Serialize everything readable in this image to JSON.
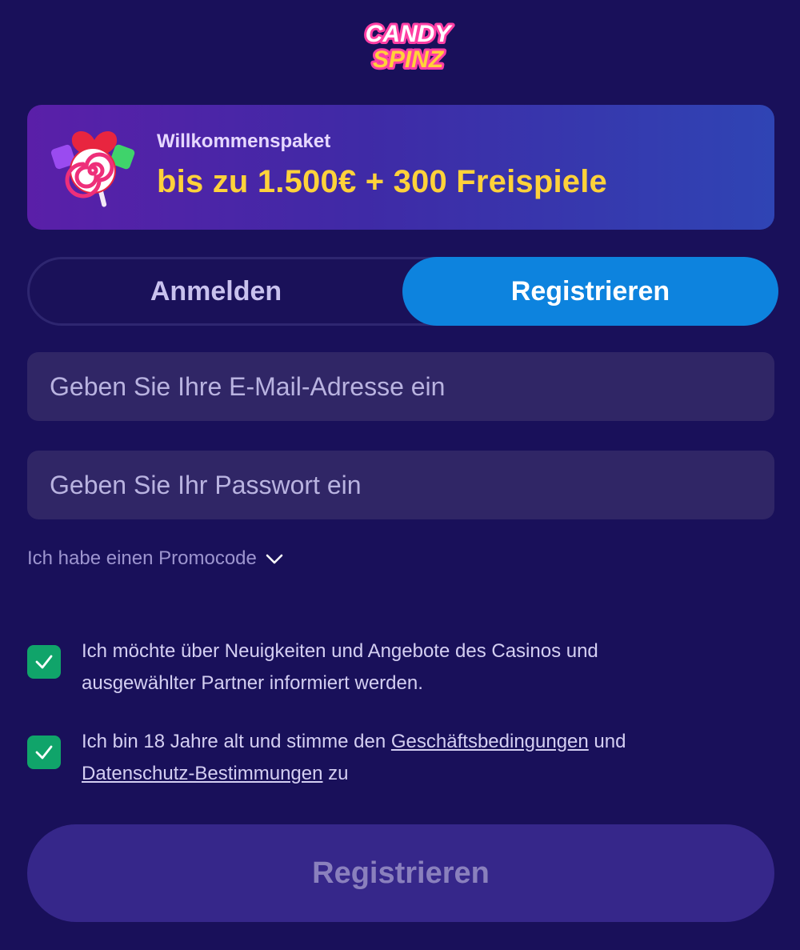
{
  "logo": {
    "line1": "CANDY",
    "line2": "SPINZ"
  },
  "banner": {
    "icon": "candy-lollipop-icon",
    "label": "Willkommenspaket",
    "offer": "bis zu 1.500€ + 300 Freispiele"
  },
  "tabs": {
    "login": "Anmelden",
    "register": "Registrieren",
    "active": "register"
  },
  "form": {
    "email_placeholder": "Geben Sie Ihre E-Mail-Adresse ein",
    "email_value": "",
    "password_placeholder": "Geben Sie Ihr Passwort ein",
    "password_value": "",
    "promo_label": "Ich habe einen Promocode",
    "promo_icon": "chevron-down-icon",
    "newsletter": {
      "checked": true,
      "text": "Ich möchte über Neuigkeiten und Angebote des Casinos und ausgewählter Partner informiert werden."
    },
    "terms": {
      "checked": true,
      "text_before": "Ich bin 18 Jahre alt und stimme den ",
      "terms_link": "Geschäftsbedingungen",
      "text_middle": " und ",
      "privacy_link": "Datenschutz-Bestimmungen",
      "text_after": " zu"
    },
    "submit_label": "Registrieren"
  },
  "colors": {
    "background": "#19105a",
    "accent_blue": "#0d83de",
    "offer_yellow": "#ffd23a",
    "checkbox_green": "#10a46a",
    "submit_disabled": "#36278a"
  }
}
